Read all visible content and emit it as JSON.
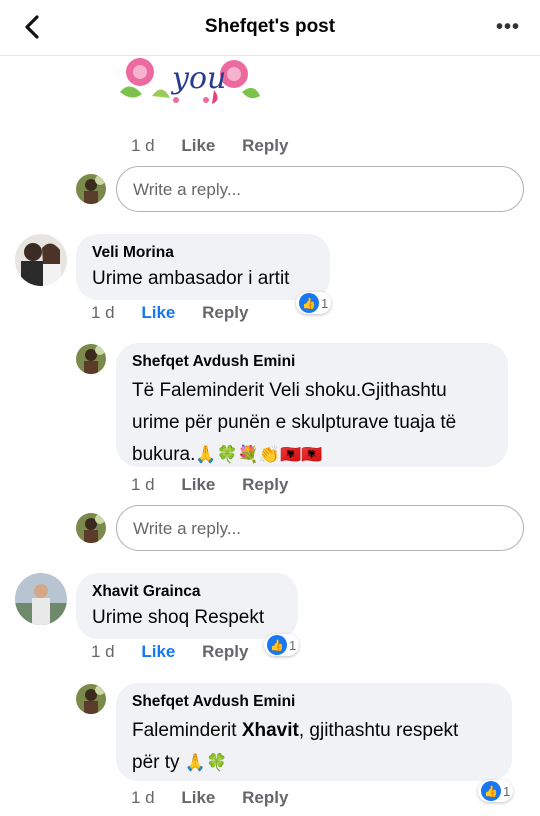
{
  "header": {
    "title": "Shefqet's post"
  },
  "top_meta": {
    "time": "1 d",
    "like": "Like",
    "reply": "Reply"
  },
  "reply_placeholder": "Write a reply...",
  "comments": [
    {
      "name": "Veli Morina",
      "text": "Urime ambasador i artit",
      "time": "1 d",
      "like": "Like",
      "reply": "Reply",
      "reactions": "1"
    },
    {
      "name": "Shefqet Avdush Emini",
      "text_lines": [
        "Të Faleminderit Veli shoku.Gjithashtu",
        "urime për punën e skulpturave tuaja të",
        "bukura."
      ],
      "emojis": "🙏🍀💐👏🇦🇱🇦🇱",
      "time": "1 d",
      "like": "Like",
      "reply": "Reply"
    },
    {
      "name": "Xhavit Grainca",
      "text": "Urime shoq Respekt",
      "time": "1 d",
      "like": "Like",
      "reply": "Reply",
      "reactions": "1"
    },
    {
      "name": "Shefqet Avdush Emini",
      "text_pre": "Faleminderit ",
      "text_bold": "Xhavit",
      "text_post": ", gjithashtu respekt",
      "text_line2": "për ty ",
      "emojis": "🙏🍀",
      "time": "1 d",
      "like": "Like",
      "reply": "Reply",
      "reactions": "1"
    }
  ],
  "colors": {
    "link_blue": "#1877f2",
    "bubble_bg": "#f0f2f5",
    "meta_gray": "#65676b"
  },
  "icons": [
    "chevron-left-icon",
    "more-dots-icon",
    "like-thumb-icon"
  ]
}
